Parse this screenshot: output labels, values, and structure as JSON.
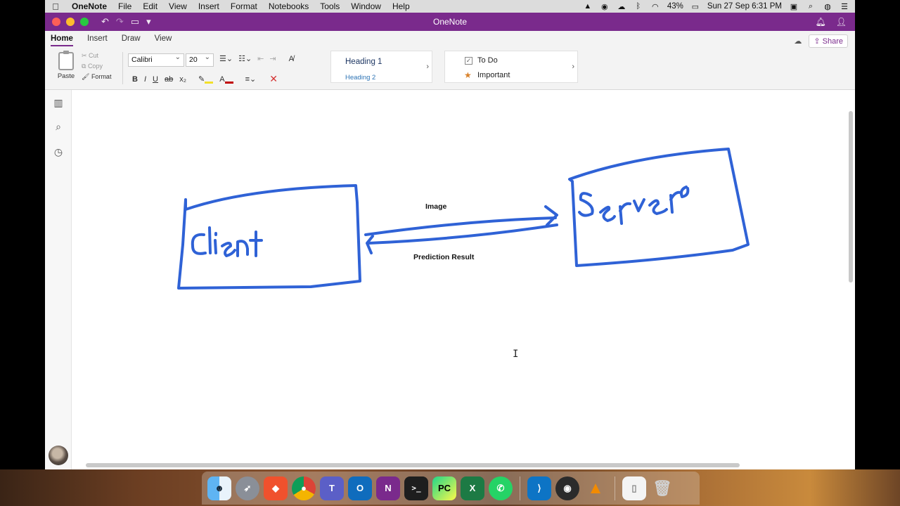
{
  "menubar": {
    "app": "OneNote",
    "items": [
      "File",
      "Edit",
      "View",
      "Insert",
      "Format",
      "Notebooks",
      "Tools",
      "Window",
      "Help"
    ],
    "battery": "43%",
    "datetime": "Sun 27 Sep  6:31 PM"
  },
  "window": {
    "title": "OneNote"
  },
  "ribbon": {
    "tabs": [
      "Home",
      "Insert",
      "Draw",
      "View"
    ],
    "share_label": "Share",
    "paste_label": "Paste",
    "cut_label": "Cut",
    "copy_label": "Copy",
    "format_label": "Format",
    "font_name": "Calibri",
    "font_size": "20",
    "bold": "B",
    "italic": "I",
    "underline": "U",
    "strike": "ab",
    "subscript": "x₂",
    "styles": {
      "heading1": "Heading 1",
      "heading2": "Heading 2"
    },
    "tags": {
      "todo": "To Do",
      "important": "Important"
    }
  },
  "page": {
    "label_image": "Image",
    "label_prediction": "Prediction Result"
  },
  "colors": {
    "accent": "#7a2a8c",
    "ink": "#2f62d6",
    "close": "#fe5f57",
    "minimize": "#febc2e",
    "zoom": "#28c840"
  },
  "dock": [
    "finder-icon",
    "launchpad-icon",
    "brave-icon",
    "chrome-icon",
    "teams-icon",
    "outlook-icon",
    "onenote-icon",
    "terminal-icon",
    "pycharm-icon",
    "excel-icon",
    "whatsapp-icon",
    "vscode-icon",
    "obs-icon",
    "vlc-icon",
    "document-icon",
    "trash-icon"
  ]
}
